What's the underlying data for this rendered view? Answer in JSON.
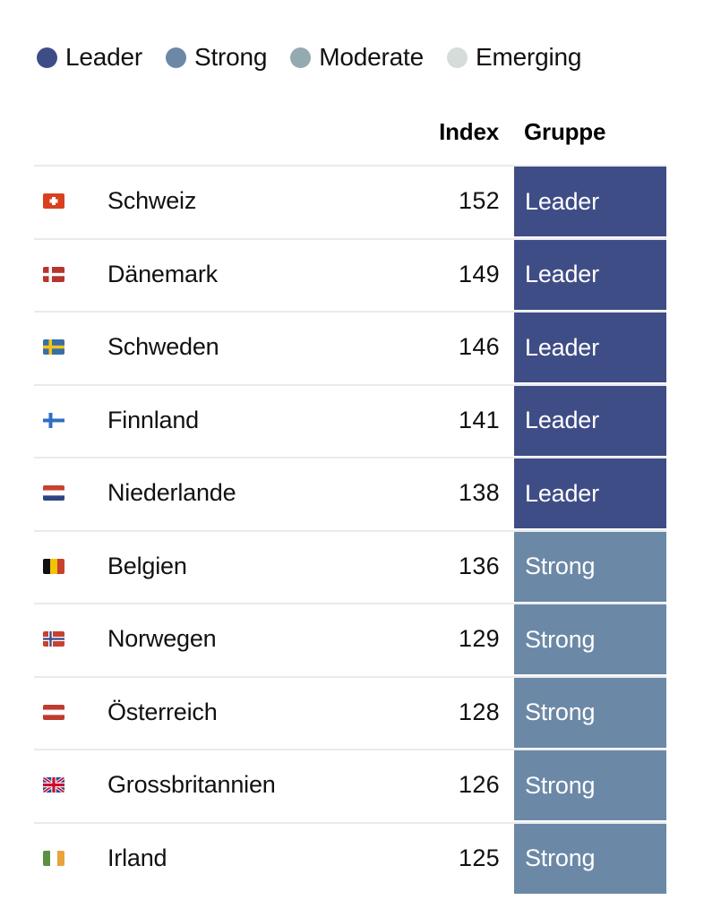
{
  "legend": {
    "items": [
      {
        "label": "Leader",
        "color": "#3f4d86",
        "icon": "legend-dot-icon"
      },
      {
        "label": "Strong",
        "color": "#6b88a6",
        "icon": "legend-dot-icon"
      },
      {
        "label": "Moderate",
        "color": "#94aab0",
        "icon": "legend-dot-icon"
      },
      {
        "label": "Emerging",
        "color": "#d5dcda",
        "icon": "legend-dot-icon"
      }
    ]
  },
  "table": {
    "headers": {
      "flag": "",
      "country": "",
      "index": "Index",
      "group": "Gruppe"
    },
    "rows": [
      {
        "flag": "flag-switzerland-icon",
        "country": "Schweiz",
        "index": "152",
        "group": "Leader",
        "group_color": "#3f4d86"
      },
      {
        "flag": "flag-denmark-icon",
        "country": "Dänemark",
        "index": "149",
        "group": "Leader",
        "group_color": "#3f4d86"
      },
      {
        "flag": "flag-sweden-icon",
        "country": "Schweden",
        "index": "146",
        "group": "Leader",
        "group_color": "#3f4d86"
      },
      {
        "flag": "flag-finland-icon",
        "country": "Finnland",
        "index": "141",
        "group": "Leader",
        "group_color": "#3f4d86"
      },
      {
        "flag": "flag-netherlands-icon",
        "country": "Niederlande",
        "index": "138",
        "group": "Leader",
        "group_color": "#3f4d86"
      },
      {
        "flag": "flag-belgium-icon",
        "country": "Belgien",
        "index": "136",
        "group": "Strong",
        "group_color": "#6b88a6"
      },
      {
        "flag": "flag-norway-icon",
        "country": "Norwegen",
        "index": "129",
        "group": "Strong",
        "group_color": "#6b88a6"
      },
      {
        "flag": "flag-austria-icon",
        "country": "Österreich",
        "index": "128",
        "group": "Strong",
        "group_color": "#6b88a6"
      },
      {
        "flag": "flag-unitedkingdom-icon",
        "country": "Grossbritannien",
        "index": "126",
        "group": "Strong",
        "group_color": "#6b88a6"
      },
      {
        "flag": "flag-ireland-icon",
        "country": "Irland",
        "index": "125",
        "group": "Strong",
        "group_color": "#6b88a6"
      }
    ]
  },
  "colors": {
    "leader": "#3f4d86",
    "strong": "#6b88a6",
    "moderate": "#94aab0",
    "emerging": "#d5dcda",
    "divider": "#e9eaee",
    "background": "#ffffff",
    "text": "#111111"
  },
  "chart_data": {
    "type": "table",
    "title": "",
    "categories": [
      "Schweiz",
      "Dänemark",
      "Schweden",
      "Finnland",
      "Niederlande",
      "Belgien",
      "Norwegen",
      "Österreich",
      "Grossbritannien",
      "Irland"
    ],
    "values": [
      152,
      149,
      146,
      141,
      138,
      136,
      129,
      128,
      126,
      125
    ],
    "columns": [
      "Index",
      "Gruppe"
    ],
    "groups": [
      "Leader",
      "Leader",
      "Leader",
      "Leader",
      "Leader",
      "Strong",
      "Strong",
      "Strong",
      "Strong",
      "Strong"
    ],
    "legend_entries": [
      "Leader",
      "Strong",
      "Moderate",
      "Emerging"
    ],
    "legend_colors": [
      "#3f4d86",
      "#6b88a6",
      "#94aab0",
      "#d5dcda"
    ],
    "legend_position": "top-left",
    "xlabel": "",
    "ylabel": "",
    "grid": false
  }
}
